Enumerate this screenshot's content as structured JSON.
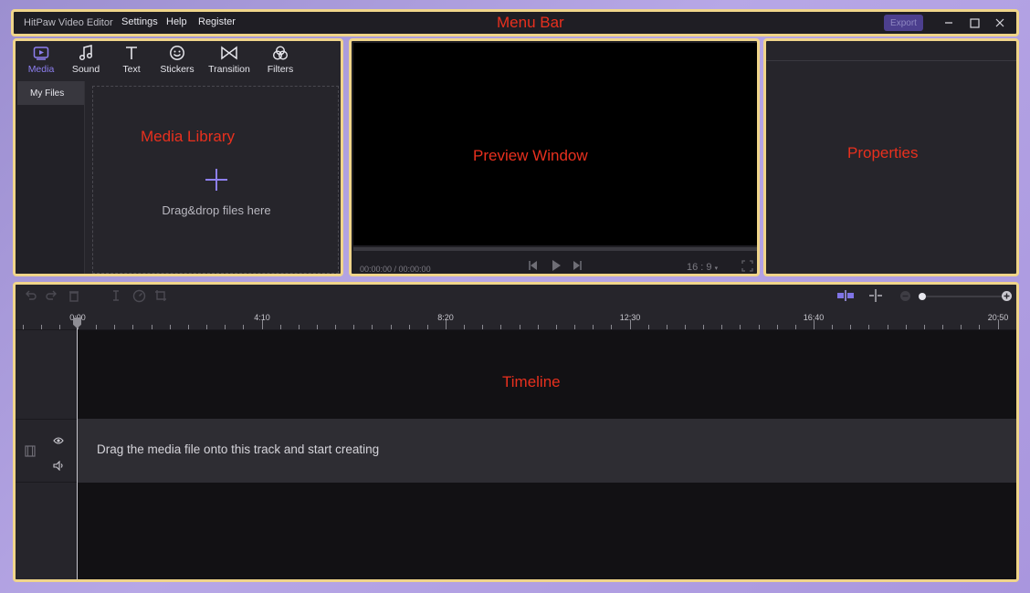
{
  "menubar": {
    "app_title": "HitPaw Video Editor",
    "menus": [
      "Settings",
      "Help",
      "Register"
    ],
    "export_label": "Export",
    "annotation": "Menu Bar"
  },
  "media_library": {
    "tabs": [
      {
        "label": "Media",
        "icon": "media-icon"
      },
      {
        "label": "Sound",
        "icon": "music-note-icon"
      },
      {
        "label": "Text",
        "icon": "text-icon"
      },
      {
        "label": "Stickers",
        "icon": "sticker-smiley-icon"
      },
      {
        "label": "Transition",
        "icon": "transition-bowtie-icon"
      },
      {
        "label": "Filters",
        "icon": "filters-icon"
      }
    ],
    "active_tab": "Media",
    "sidebar_item": "My Files",
    "drop_text": "Drag&drop files here",
    "annotation": "Media Library"
  },
  "preview": {
    "time": "00:00:00 / 00:00:00",
    "ratio": "16 : 9",
    "annotation": "Preview Window"
  },
  "properties": {
    "annotation": "Properties"
  },
  "timeline": {
    "ruler_labels": [
      "0:00",
      "4:10",
      "8:20",
      "12:30",
      "16:40",
      "20:50"
    ],
    "track_hint": "Drag the media file onto this track and start creating",
    "annotation": "Timeline"
  },
  "colors": {
    "accent": "#8d7ff0",
    "annotation_frame": "#f0d58a",
    "annotation_text": "#e8301e"
  }
}
